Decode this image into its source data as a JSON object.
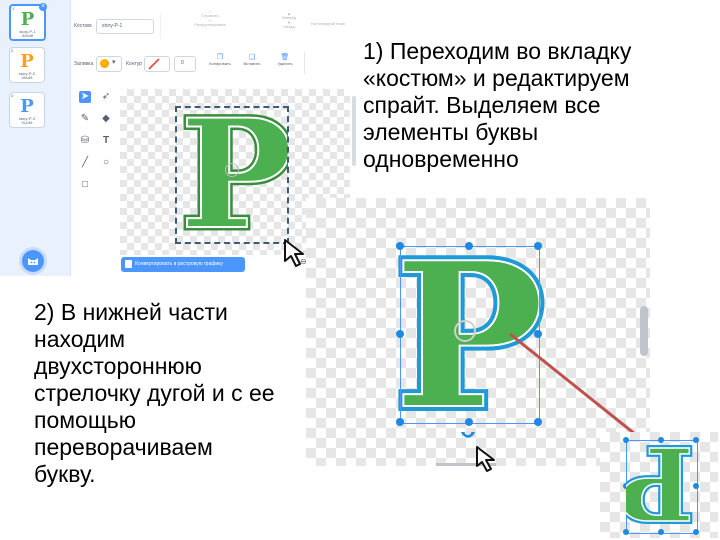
{
  "editor": {
    "costume_label": "Костюм",
    "costume_name": "story-P-1",
    "forward_label": "Вперёд",
    "backward_label": "Назад",
    "to_front_label": "На передний план",
    "flip_h_label": "Отразить",
    "flip_v_label": "Разгруппировать",
    "fill_label": "Заливка",
    "outline_label": "Контур",
    "outline_width": "0",
    "copy_label": "Копировать",
    "paste_label": "Вставить",
    "delete_label": "Удалить",
    "convert_button": "Конвертировать в растровую графику",
    "zoom_equal": "=",
    "costumes": [
      {
        "num": "1",
        "letter": "P",
        "name": "story-P-1",
        "size": "40x48",
        "color": "#4caf50"
      },
      {
        "num": "2",
        "letter": "P",
        "name": "story-P-2",
        "size": "40x48",
        "color": "#ff9f1c"
      },
      {
        "num": "3",
        "letter": "P",
        "name": "story-P-3",
        "size": "31x36",
        "color": "#4c97ff"
      }
    ]
  },
  "canvas_letter": "P",
  "rotated_letter": "P",
  "captions": {
    "step1": [
      "1) Переходим во вкладку",
      "«костюм» и редактируем",
      "спрайт. Выделяем все",
      "элементы буквы",
      "одновременно"
    ],
    "step2": [
      "2) В нижней части",
      "находим",
      "двухстороннюю",
      "стрелочку дугой и с ее",
      "помощью",
      "переворачиваем",
      "букву."
    ]
  },
  "colors": {
    "scratch_blue": "#4c97ff",
    "letter_green": "#4caf50",
    "outline_blue": "#1e9bd7",
    "arrow_red": "#c0504d",
    "sidebar_bg": "#e9f1fc"
  },
  "icons": [
    "select-arrow-icon",
    "reshape-icon",
    "brush-icon",
    "eraser-icon",
    "fill-icon",
    "text-icon",
    "line-icon",
    "circle-icon",
    "rect-icon",
    "zoom-in-icon",
    "zoom-out-icon",
    "cursor-icon",
    "rotate-handle-icon"
  ]
}
